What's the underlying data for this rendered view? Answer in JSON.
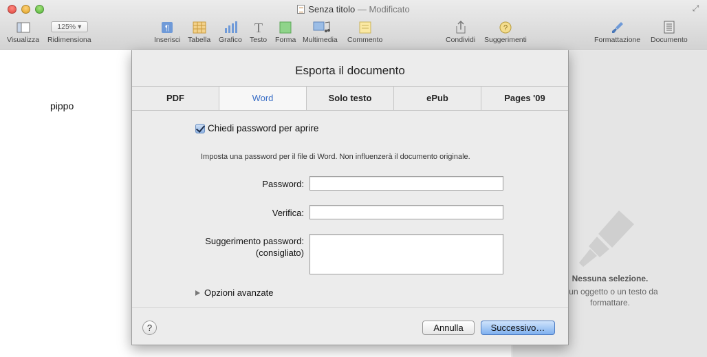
{
  "window": {
    "title": "Senza titolo",
    "separator": "—",
    "subtitle": "Modificato"
  },
  "toolbar": {
    "view_label": "Visualizza",
    "zoom_value": "125%",
    "zoom_label": "Ridimensiona",
    "insert_label": "Inserisci",
    "table_label": "Tabella",
    "chart_label": "Grafico",
    "text_label": "Testo",
    "shape_label": "Forma",
    "media_label": "Multimedia",
    "comment_label": "Commento",
    "share_label": "Condividi",
    "tips_label": "Suggerimenti",
    "format_label": "Formattazione",
    "document_label": "Documento"
  },
  "document": {
    "body_text": "pippo"
  },
  "inspector": {
    "no_selection_title": "Nessuna selezione.",
    "no_selection_line1": "a un oggetto o un testo da",
    "no_selection_line2": "formattare."
  },
  "dialog": {
    "title": "Esporta il documento",
    "tabs": [
      {
        "label": "PDF"
      },
      {
        "label": "Word"
      },
      {
        "label": "Solo testo"
      },
      {
        "label": "ePub"
      },
      {
        "label": "Pages '09"
      }
    ],
    "selected_tab": "Word",
    "checkbox_label": "Chiedi password per aprire",
    "checkbox_checked": true,
    "info_text": "Imposta una password per il file di Word. Non influenzerà il documento originale.",
    "password_label": "Password:",
    "password_value": "",
    "verify_label": "Verifica:",
    "verify_value": "",
    "hint_label_line1": "Suggerimento password:",
    "hint_label_line2": "(consigliato)",
    "hint_value": "",
    "advanced_label": "Opzioni avanzate",
    "help_label": "?",
    "cancel_label": "Annulla",
    "next_label": "Successivo…"
  },
  "colors": {
    "accent": "#3b6fc6",
    "primary_button": "#7fb0ef",
    "inspector_bg": "#e5e5e5"
  }
}
